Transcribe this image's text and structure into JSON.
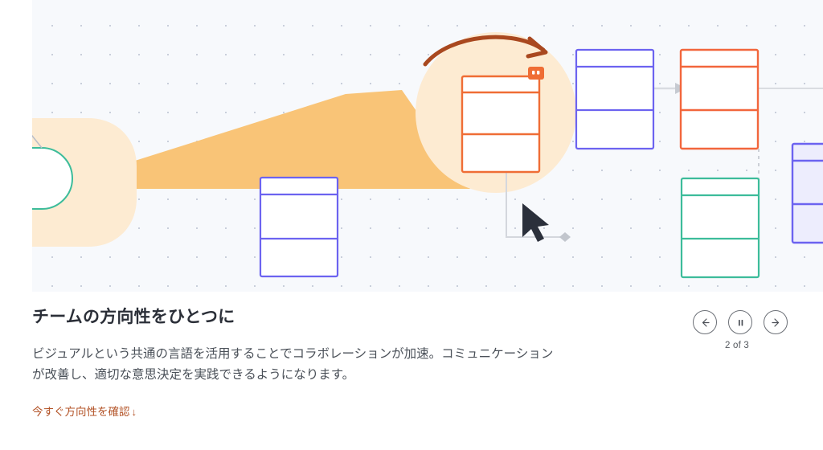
{
  "slide": {
    "headline": "チームの方向性をひとつに",
    "body": "ビジュアルという共通の言語を活用することでコラボレーションが加速。コミュニケーションが改善し、適切な意思決定を実践できるようになります。",
    "cta_label": "今すぐ方向性を確認",
    "cta_arrow": "↓"
  },
  "carousel": {
    "prev_label": "←",
    "pause_label": "❙❙",
    "next_label": "→",
    "counter": "2 of 3",
    "current": 2,
    "total": 3
  },
  "illustration": {
    "alt": "diagram-canvas",
    "grid": "dotted",
    "icons": {
      "comment_badge": "comment-badge-icon",
      "cursor": "mouse-cursor-icon",
      "curved_arrow": "curved-arrow-icon"
    },
    "shapes": [
      {
        "name": "pill-shape-green",
        "color": "#3cbc9a"
      },
      {
        "name": "card-blue-left",
        "color": "#6c63f0"
      },
      {
        "name": "card-orange-focus",
        "color": "#ef6d35"
      },
      {
        "name": "card-blue-top",
        "color": "#6c63f0"
      },
      {
        "name": "card-orange-right",
        "color": "#f2663c"
      },
      {
        "name": "card-green-right",
        "color": "#3cbc9a"
      },
      {
        "name": "card-lavender-edge",
        "color": "#6c63f0"
      },
      {
        "name": "blob-peach",
        "color": "#fdebd2"
      },
      {
        "name": "blob-orange",
        "color": "#f9c477"
      }
    ]
  },
  "colors": {
    "canvas_bg": "#f7f9fc",
    "grid_dot": "#c9cfdb",
    "blue": "#6c63f0",
    "orange": "#ef6d35",
    "green": "#3cbc9a",
    "lavender_fill": "#ededfd",
    "peach": "#fdebd2",
    "amber": "#f9c477",
    "arrow_brown": "#a9481f",
    "connector_gray": "#c9ccd2",
    "cursor": "#2b303b",
    "heading": "#2b2f38",
    "body": "#4a5058",
    "cta": "#b35327"
  }
}
